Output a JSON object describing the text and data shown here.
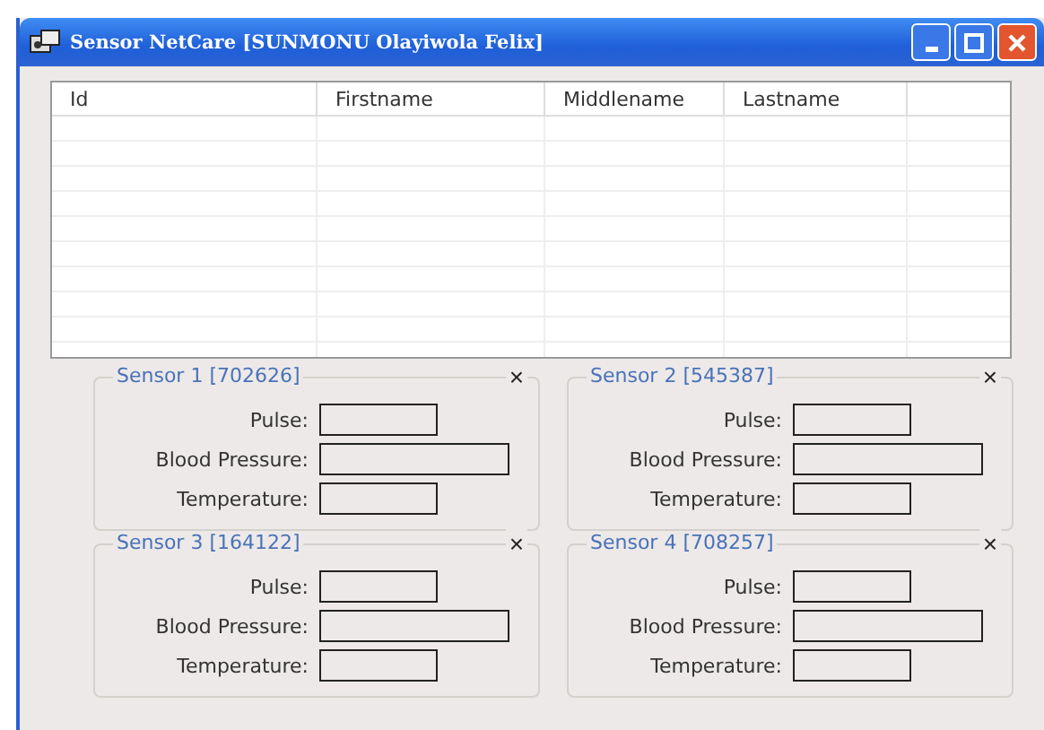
{
  "window": {
    "title": "Sensor NetCare [SUNMONU Olayiwola Felix]"
  },
  "table": {
    "columns": [
      "Id",
      "Firstname",
      "Middlename",
      "Lastname"
    ]
  },
  "sensors": [
    {
      "title": "Sensor 1 [702626]",
      "close": "×",
      "fields": [
        {
          "label": "Pulse:"
        },
        {
          "label": "Blood Pressure:"
        },
        {
          "label": "Temperature:"
        }
      ]
    },
    {
      "title": "Sensor 2 [545387]",
      "close": "×",
      "fields": [
        {
          "label": "Pulse:"
        },
        {
          "label": "Blood Pressure:"
        },
        {
          "label": "Temperature:"
        }
      ]
    },
    {
      "title": "Sensor 3 [164122]",
      "close": "×",
      "fields": [
        {
          "label": "Pulse:"
        },
        {
          "label": "Blood Pressure:"
        },
        {
          "label": "Temperature:"
        }
      ]
    },
    {
      "title": "Sensor 4 [708257]",
      "close": "×",
      "fields": [
        {
          "label": "Pulse:"
        },
        {
          "label": "Blood Pressure:"
        },
        {
          "label": "Temperature:"
        }
      ]
    }
  ]
}
